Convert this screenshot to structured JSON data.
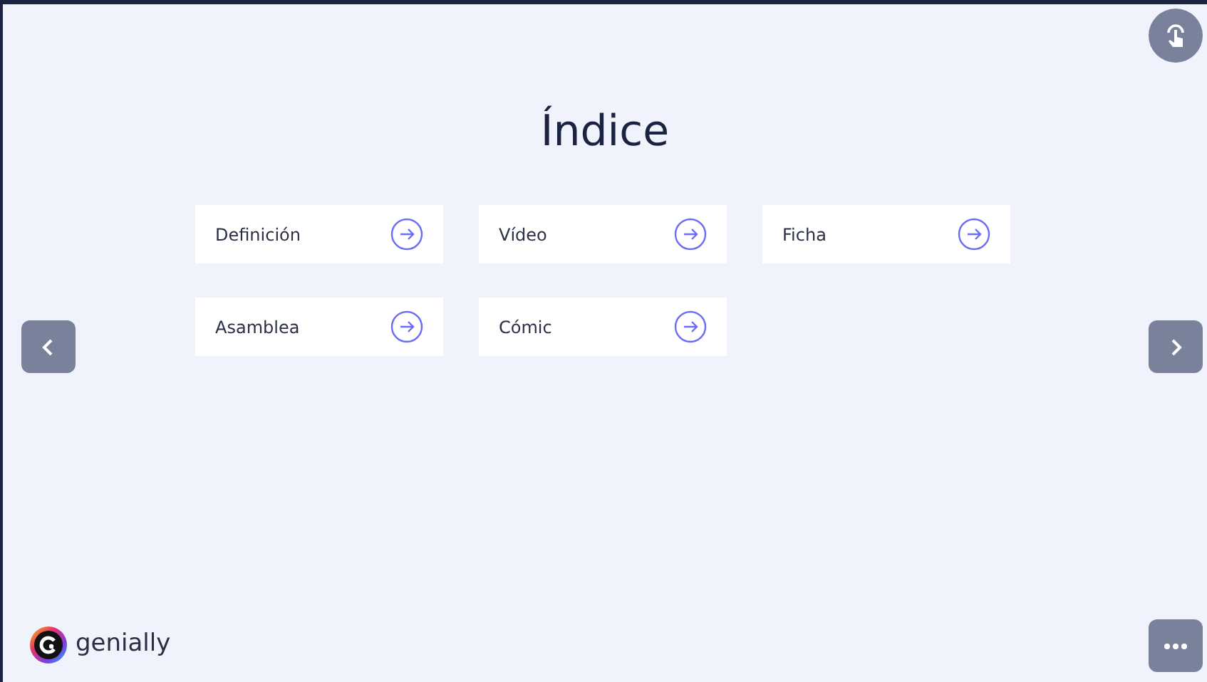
{
  "title": "Índice",
  "items": [
    {
      "label": "Definición"
    },
    {
      "label": "Vídeo"
    },
    {
      "label": "Ficha"
    },
    {
      "label": "Asamblea"
    },
    {
      "label": "Cómic"
    }
  ],
  "brand": "genially"
}
